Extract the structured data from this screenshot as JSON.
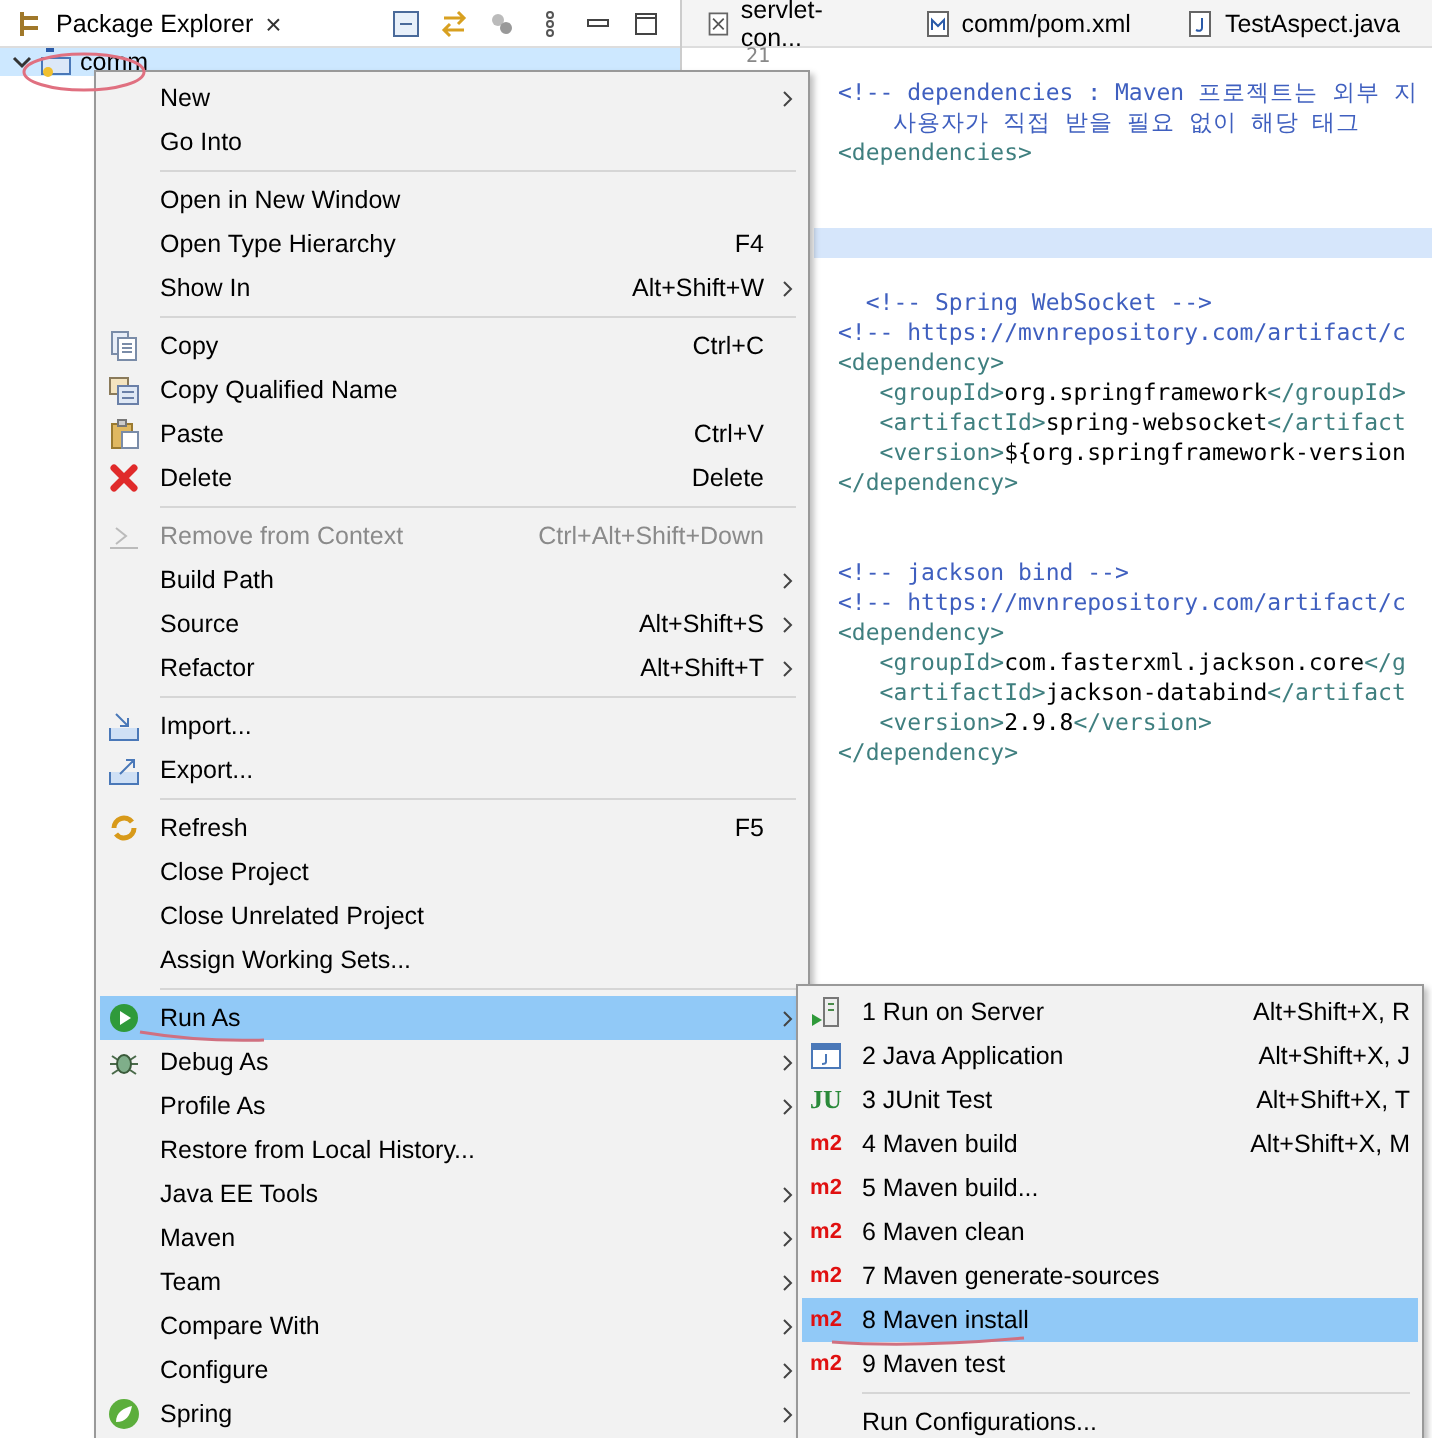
{
  "explorer": {
    "title": "Package Explorer",
    "close": "×",
    "tree": [
      {
        "label": "comm",
        "expanded": true,
        "selected": true
      }
    ]
  },
  "editor": {
    "tabs": [
      {
        "label": "servlet-con...",
        "kind": "xml"
      },
      {
        "label": "comm/pom.xml",
        "kind": "maven"
      },
      {
        "label": "TestAspect.java",
        "kind": "java"
      }
    ],
    "line_number": "21",
    "lines": [
      {
        "highlighted": false
      },
      {
        "highlighted": false,
        "segments": [
          {
            "kind": "comment",
            "text": "<!-- dependencies : Maven 프로젝트는 외부 지"
          }
        ]
      },
      {
        "highlighted": false,
        "segments": [
          {
            "kind": "comment",
            "text": "    사용자가 직접 받을 필요 없이 해당 태그 "
          }
        ]
      },
      {
        "highlighted": false,
        "segments": [
          {
            "kind": "tag",
            "text": "<dependencies>"
          }
        ]
      },
      {
        "highlighted": false
      },
      {
        "highlighted": false
      },
      {
        "highlighted": true
      },
      {
        "highlighted": false
      },
      {
        "highlighted": false,
        "segments": [
          {
            "kind": "comment",
            "text": "  <!-- Spring WebSocket -->"
          }
        ]
      },
      {
        "highlighted": false,
        "segments": [
          {
            "kind": "comment",
            "text": "<!-- https://mvnrepository.com/artifact/c"
          }
        ]
      },
      {
        "highlighted": false,
        "segments": [
          {
            "kind": "tag",
            "text": "<dependency>"
          }
        ]
      },
      {
        "highlighted": false,
        "segments": [
          {
            "kind": "tag",
            "text": "   <groupId>"
          },
          {
            "kind": "text",
            "text": "org.springframework"
          },
          {
            "kind": "tag",
            "text": "</groupId>"
          }
        ]
      },
      {
        "highlighted": false,
        "segments": [
          {
            "kind": "tag",
            "text": "   <artifactId>"
          },
          {
            "kind": "text",
            "text": "spring-websocket"
          },
          {
            "kind": "tag",
            "text": "</artifact"
          }
        ]
      },
      {
        "highlighted": false,
        "segments": [
          {
            "kind": "tag",
            "text": "   <version>"
          },
          {
            "kind": "text",
            "text": "${org.springframework-version"
          }
        ]
      },
      {
        "highlighted": false,
        "segments": [
          {
            "kind": "tag",
            "text": "</dependency>"
          }
        ]
      },
      {
        "highlighted": false
      },
      {
        "highlighted": false
      },
      {
        "highlighted": false,
        "segments": [
          {
            "kind": "comment",
            "text": "<!-- jackson bind -->"
          }
        ]
      },
      {
        "highlighted": false,
        "segments": [
          {
            "kind": "comment",
            "text": "<!-- https://mvnrepository.com/artifact/c"
          }
        ]
      },
      {
        "highlighted": false,
        "segments": [
          {
            "kind": "tag",
            "text": "<dependency>"
          }
        ]
      },
      {
        "highlighted": false,
        "segments": [
          {
            "kind": "tag",
            "text": "   <groupId>"
          },
          {
            "kind": "text",
            "text": "com.fasterxml.jackson.core"
          },
          {
            "kind": "tag",
            "text": "</g"
          }
        ]
      },
      {
        "highlighted": false,
        "segments": [
          {
            "kind": "tag",
            "text": "   <artifactId>"
          },
          {
            "kind": "text",
            "text": "jackson-databind"
          },
          {
            "kind": "tag",
            "text": "</artifact"
          }
        ]
      },
      {
        "highlighted": false,
        "segments": [
          {
            "kind": "tag",
            "text": "   <version>"
          },
          {
            "kind": "text",
            "text": "2.9.8"
          },
          {
            "kind": "tag",
            "text": "</version>"
          }
        ]
      },
      {
        "highlighted": false,
        "segments": [
          {
            "kind": "tag",
            "text": "</dependency>"
          }
        ]
      }
    ]
  },
  "context_menu": {
    "groups": [
      [
        {
          "label": "New",
          "submenu": true,
          "disabled": false,
          "selected": false,
          "kind": "plain"
        },
        {
          "label": "Go Into",
          "submenu": false,
          "disabled": false,
          "selected": false,
          "kind": "plain"
        }
      ],
      [
        {
          "label": "Open in New Window",
          "submenu": false,
          "disabled": false,
          "selected": false,
          "kind": "plain"
        },
        {
          "label": "Open Type Hierarchy",
          "shortcut": "F4",
          "submenu": false,
          "disabled": false,
          "selected": false,
          "kind": "plain"
        },
        {
          "label": "Show In",
          "shortcut": "Alt+Shift+W",
          "submenu": true,
          "disabled": false,
          "selected": false,
          "kind": "plain"
        }
      ],
      [
        {
          "label": "Copy",
          "shortcut": "Ctrl+C",
          "submenu": false,
          "disabled": false,
          "selected": false,
          "kind": "copy"
        },
        {
          "label": "Copy Qualified Name",
          "submenu": false,
          "disabled": false,
          "selected": false,
          "kind": "copy-name"
        },
        {
          "label": "Paste",
          "shortcut": "Ctrl+V",
          "submenu": false,
          "disabled": false,
          "selected": false,
          "kind": "paste"
        },
        {
          "label": "Delete",
          "shortcut": "Delete",
          "submenu": false,
          "disabled": false,
          "selected": false,
          "kind": "delete"
        }
      ],
      [
        {
          "label": "Remove from Context",
          "shortcut": "Ctrl+Alt+Shift+Down",
          "submenu": false,
          "disabled": true,
          "selected": false,
          "kind": "remove"
        },
        {
          "label": "Build Path",
          "submenu": true,
          "disabled": false,
          "selected": false,
          "kind": "plain"
        },
        {
          "label": "Source",
          "shortcut": "Alt+Shift+S",
          "submenu": true,
          "disabled": false,
          "selected": false,
          "kind": "plain"
        },
        {
          "label": "Refactor",
          "shortcut": "Alt+Shift+T",
          "submenu": true,
          "disabled": false,
          "selected": false,
          "kind": "plain"
        }
      ],
      [
        {
          "label": "Import...",
          "submenu": false,
          "disabled": false,
          "selected": false,
          "kind": "import"
        },
        {
          "label": "Export...",
          "submenu": false,
          "disabled": false,
          "selected": false,
          "kind": "export"
        }
      ],
      [
        {
          "label": "Refresh",
          "shortcut": "F5",
          "submenu": false,
          "disabled": false,
          "selected": false,
          "kind": "refresh"
        },
        {
          "label": "Close Project",
          "submenu": false,
          "disabled": false,
          "selected": false,
          "kind": "plain"
        },
        {
          "label": "Close Unrelated Project",
          "submenu": false,
          "disabled": false,
          "selected": false,
          "kind": "plain"
        },
        {
          "label": "Assign Working Sets...",
          "submenu": false,
          "disabled": false,
          "selected": false,
          "kind": "plain"
        }
      ],
      [
        {
          "label": "Run As",
          "submenu": true,
          "disabled": false,
          "selected": true,
          "kind": "run"
        },
        {
          "label": "Debug As",
          "submenu": true,
          "disabled": false,
          "selected": false,
          "kind": "debug"
        },
        {
          "label": "Profile As",
          "submenu": true,
          "disabled": false,
          "selected": false,
          "kind": "plain"
        },
        {
          "label": "Restore from Local History...",
          "submenu": false,
          "disabled": false,
          "selected": false,
          "kind": "plain"
        },
        {
          "label": "Java EE Tools",
          "submenu": true,
          "disabled": false,
          "selected": false,
          "kind": "plain"
        },
        {
          "label": "Maven",
          "submenu": true,
          "disabled": false,
          "selected": false,
          "kind": "plain"
        },
        {
          "label": "Team",
          "submenu": true,
          "disabled": false,
          "selected": false,
          "kind": "plain"
        },
        {
          "label": "Compare With",
          "submenu": true,
          "disabled": false,
          "selected": false,
          "kind": "plain"
        },
        {
          "label": "Configure",
          "submenu": true,
          "disabled": false,
          "selected": false,
          "kind": "plain"
        },
        {
          "label": "Spring",
          "submenu": true,
          "disabled": false,
          "selected": false,
          "kind": "spring"
        }
      ]
    ]
  },
  "submenu": {
    "groups": [
      [
        {
          "label": "1 Run on Server",
          "shortcut": "Alt+Shift+X, R",
          "selected": false,
          "kind": "server"
        },
        {
          "label": "2 Java Application",
          "shortcut": "Alt+Shift+X, J",
          "selected": false,
          "kind": "java-app"
        },
        {
          "label": "3 JUnit Test",
          "shortcut": "Alt+Shift+X, T",
          "selected": false,
          "kind": "junit",
          "icon_text": "JU"
        },
        {
          "label": "4 Maven build",
          "shortcut": "Alt+Shift+X, M",
          "selected": false,
          "kind": "maven",
          "icon_text": "m2"
        },
        {
          "label": "5 Maven build...",
          "selected": false,
          "kind": "maven",
          "icon_text": "m2"
        },
        {
          "label": "6 Maven clean",
          "selected": false,
          "kind": "maven",
          "icon_text": "m2"
        },
        {
          "label": "7 Maven generate-sources",
          "selected": false,
          "kind": "maven",
          "icon_text": "m2"
        },
        {
          "label": "8 Maven install",
          "selected": true,
          "kind": "maven",
          "icon_text": "m2"
        },
        {
          "label": "9 Maven test",
          "selected": false,
          "kind": "maven",
          "icon_text": "m2"
        }
      ],
      [
        {
          "label": "Run Configurations...",
          "selected": false,
          "kind": "plain"
        }
      ]
    ]
  }
}
